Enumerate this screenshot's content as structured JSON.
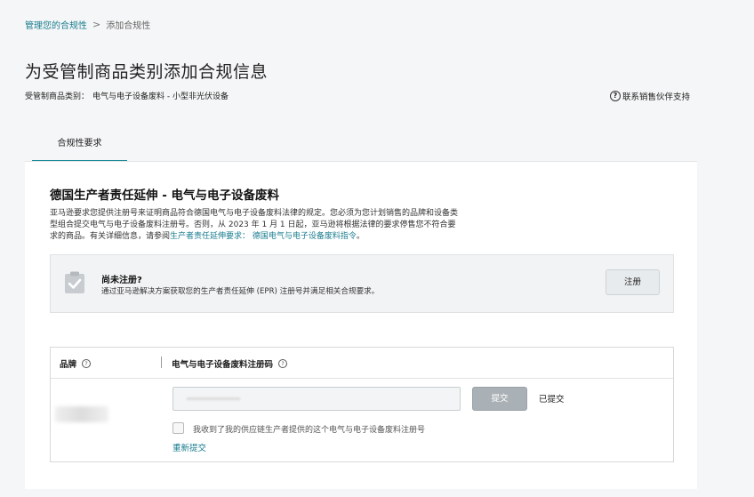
{
  "breadcrumb": {
    "parent": "管理您的合规性",
    "separator": ">",
    "current": "添加合规性"
  },
  "page": {
    "title": "为受管制商品类别添加合规信息",
    "category_label": "受管制商品类别：",
    "category_value": "电气与电子设备废料 - 小型非光伏设备",
    "support_link": "联系销售伙伴支持"
  },
  "tabs": [
    {
      "label": "合规性要求",
      "active": true
    }
  ],
  "section": {
    "title": "德国生产者责任延伸 - 电气与电子设备废料",
    "desc_1": "亚马逊要求您提供注册号来证明商品符合德国电气与电子设备废料法律的规定。您必须为您计划销售的品牌和设备类",
    "desc_2": "型组合提交电气与电子设备废料注册号。否则，从 2023 年 1 月 1 日起，亚马逊将根据法律的要求停售您不符合要",
    "desc_3a": "求的商品。有关详细信息，请参阅",
    "desc_3_link1": "生产者责任延伸要求：",
    "desc_3_link2": "德国电气与电子设备废料指令",
    "desc_3b": "。"
  },
  "notice": {
    "icon": "clipboard-check-icon",
    "title": "尚未注册?",
    "text": "通过亚马逊解决方案获取您的生产者责任延伸 (EPR) 注册号并满足相关合规要求。",
    "button": "注册"
  },
  "table": {
    "col_brand": "品牌",
    "col_code": "电气与电子设备废料注册码",
    "row": {
      "submit_button": "提交",
      "status": "已提交",
      "checkbox_label": "我收到了我的供应链生产者提供的这个电气与电子设备废料注册号",
      "resubmit_link": "重新提交"
    }
  },
  "colors": {
    "accent": "#1a8a96",
    "link": "#1a7d8f",
    "button_disabled": "#aab1b6"
  }
}
